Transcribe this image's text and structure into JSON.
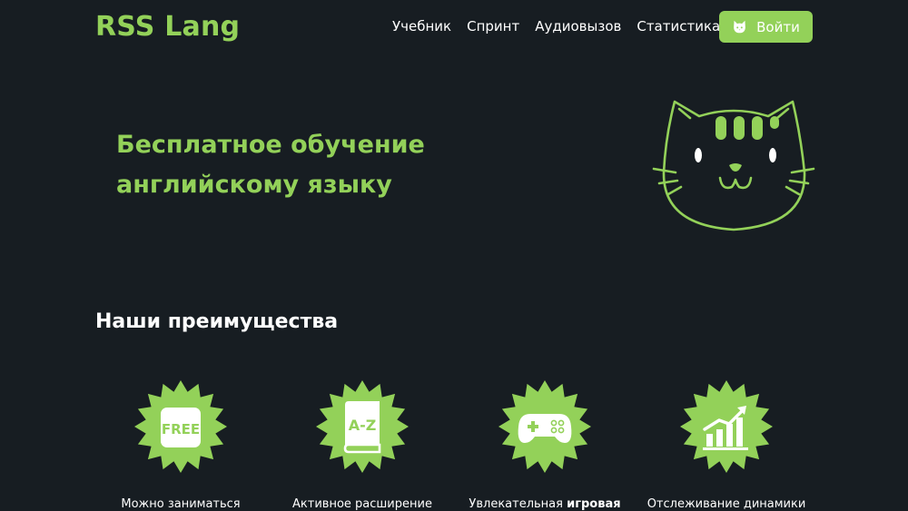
{
  "header": {
    "logo": "RSS Lang",
    "nav": [
      "Учебник",
      "Спринт",
      "Аудиовызов",
      "Статистика"
    ],
    "login_label": "Войти"
  },
  "hero": {
    "title_bold": "Бесплатное",
    "title_rest": " обучение английскому языку"
  },
  "advantages": {
    "title": "Наши преимущества",
    "items": [
      {
        "icon": "free-badge-icon",
        "badge_text": "FREE",
        "text": "Можно заниматься",
        "text_bold": ""
      },
      {
        "icon": "dictionary-icon",
        "badge_text": "A-Z",
        "text": "Активное расширение",
        "text_bold": ""
      },
      {
        "icon": "gamepad-icon",
        "badge_text": "",
        "text": "Увлекательная ",
        "text_bold": "игровая"
      },
      {
        "icon": "chart-growth-icon",
        "badge_text": "",
        "text": "Отслеживание динамики",
        "text_bold": ""
      }
    ]
  },
  "colors": {
    "accent": "#93d159",
    "background": "#171d22",
    "text": "#ffffff"
  }
}
